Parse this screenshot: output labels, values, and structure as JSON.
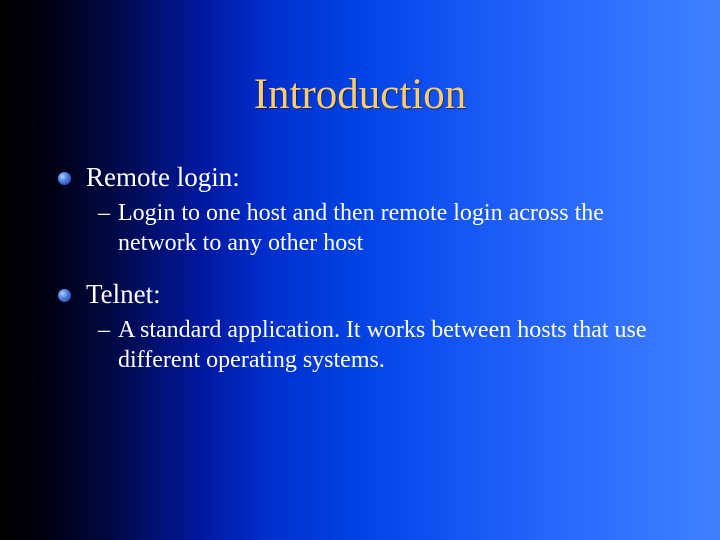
{
  "title": "Introduction",
  "items": [
    {
      "label": "Remote login:",
      "sub": "Login to one host and then remote login across the network to any other host"
    },
    {
      "label": "Telnet:",
      "sub": "A standard application. It works between hosts that use different operating systems."
    }
  ],
  "dash": "–"
}
